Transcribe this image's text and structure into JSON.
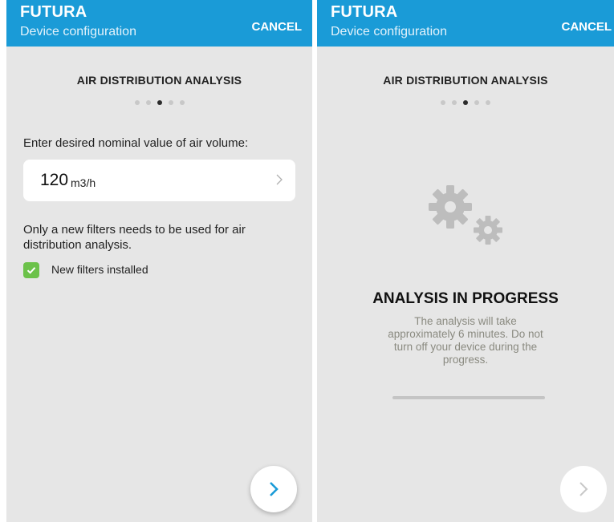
{
  "left_screen": {
    "app_title": "FUTURA",
    "app_subtitle": "Device configuration",
    "cancel_label": "CANCEL",
    "step_title": "AIR DISTRIBUTION ANALYSIS",
    "step_total": 5,
    "step_current": 3,
    "prompt": "Enter desired nominal value of air volume:",
    "volume_value": "120",
    "volume_unit": "m3/h",
    "info_text": "Only a new filters needs to be used for air distribution analysis.",
    "checkbox_label": "New filters installed",
    "checkbox_checked": true,
    "next_icon": "chevron-right-icon"
  },
  "right_screen": {
    "app_title": "FUTURA",
    "app_subtitle": "Device configuration",
    "cancel_label": "CANCEL",
    "step_title": "AIR DISTRIBUTION ANALYSIS",
    "step_total": 5,
    "step_current": 3,
    "icon": "gears-icon",
    "analysis_title": "ANALYSIS IN PROGRESS",
    "analysis_description": "The analysis will take approximately 6 minutes. Do not turn off your device during the progress.",
    "progress": 0,
    "next_icon": "chevron-right-icon",
    "next_enabled": false
  },
  "colors": {
    "app_bar": "#1a9bd7",
    "screen_background": "#e6e6e6",
    "checkbox": "#6cc24a",
    "next_chevron_enabled": "#1a9bd7",
    "next_chevron_disabled": "#c8c8c8",
    "description_text": "#8a8a80"
  }
}
